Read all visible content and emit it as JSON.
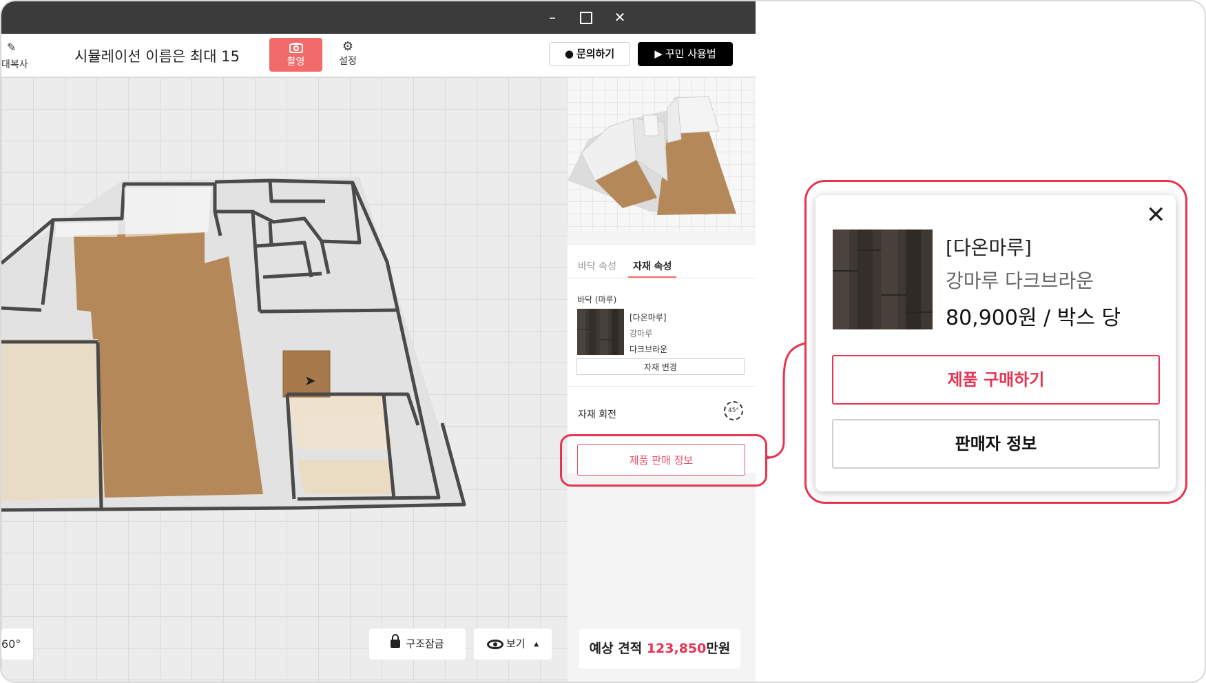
{
  "window": {
    "minimize": "–",
    "close": "✕"
  },
  "toolbar": {
    "copy_label": "대복사",
    "sim_title": "시뮬레이션 이름은 최대 15",
    "capture_label": "촬영",
    "settings_label": "설정",
    "inquiry_label": "문의하기",
    "guide_label": "꾸민 사용법"
  },
  "viewport": {
    "angle": "60°",
    "lock_label": "구조잠금",
    "view_label": "보기",
    "view_caret": "▲"
  },
  "panel": {
    "tabs": [
      {
        "label": "바닥 속성"
      },
      {
        "label": "자재 속성"
      }
    ],
    "floor_label": "바닥 (마루)",
    "material": {
      "brand": "[다온마루]",
      "type": "강마루",
      "color": "다크브라운"
    },
    "change_material_label": "자재 변경",
    "rotate_label": "자재 회전",
    "rotate_value": "45°",
    "sale_info_label": "제품 판매 정보",
    "estimate_prefix": "예상 견적 ",
    "estimate_value": "123,850",
    "estimate_unit": "만원"
  },
  "popup": {
    "close": "✕",
    "brand": "[다온마루]",
    "name": "강마루 다크브라운",
    "price": "80,900원 / 박스 당",
    "buy_label": "제품 구매하기",
    "seller_label": "판매자 정보"
  },
  "colors": {
    "accent": "#e8334f",
    "capture": "#f26b6b",
    "wood": "#b5885a",
    "wood_dark": "#3e3834",
    "wall": "#4a4a4a"
  }
}
